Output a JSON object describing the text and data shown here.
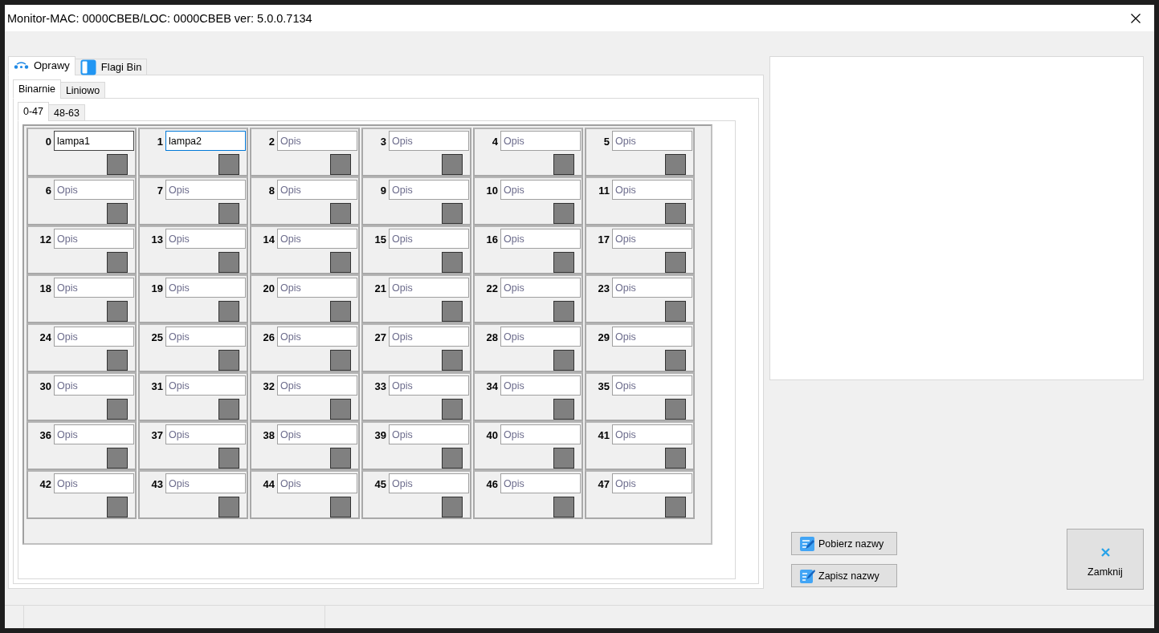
{
  "window": {
    "title": "Monitor-MAC: 0000CBEB/LOC: 0000CBEB ver: 5.0.0.7134"
  },
  "main_tabs": [
    {
      "label": "Oprawy",
      "kind": "lamps",
      "selected": true
    },
    {
      "label": "Flagi Bin",
      "kind": "flags",
      "selected": false
    }
  ],
  "mode_tabs": [
    {
      "label": "Binarnie",
      "selected": true
    },
    {
      "label": "Liniowo",
      "selected": false
    }
  ],
  "range_tabs": [
    {
      "label": "0-47",
      "selected": true
    },
    {
      "label": "48-63",
      "selected": false
    }
  ],
  "cells": [
    {
      "number": "0",
      "value": "lampa1",
      "focused": false
    },
    {
      "number": "1",
      "value": "lampa2",
      "focused": true
    },
    {
      "number": "2",
      "placeholder": "Opis",
      "focused": false
    },
    {
      "number": "3",
      "placeholder": "Opis",
      "focused": false
    },
    {
      "number": "4",
      "placeholder": "Opis",
      "focused": false
    },
    {
      "number": "5",
      "placeholder": "Opis",
      "focused": false
    },
    {
      "number": "6",
      "placeholder": "Opis",
      "focused": false
    },
    {
      "number": "7",
      "placeholder": "Opis",
      "focused": false
    },
    {
      "number": "8",
      "placeholder": "Opis",
      "focused": false
    },
    {
      "number": "9",
      "placeholder": "Opis",
      "focused": false
    },
    {
      "number": "10",
      "placeholder": "Opis",
      "focused": false
    },
    {
      "number": "11",
      "placeholder": "Opis",
      "focused": false
    },
    {
      "number": "12",
      "placeholder": "Opis",
      "focused": false
    },
    {
      "number": "13",
      "placeholder": "Opis",
      "focused": false
    },
    {
      "number": "14",
      "placeholder": "Opis",
      "focused": false
    },
    {
      "number": "15",
      "placeholder": "Opis",
      "focused": false
    },
    {
      "number": "16",
      "placeholder": "Opis",
      "focused": false
    },
    {
      "number": "17",
      "placeholder": "Opis",
      "focused": false
    },
    {
      "number": "18",
      "placeholder": "Opis",
      "focused": false
    },
    {
      "number": "19",
      "placeholder": "Opis",
      "focused": false
    },
    {
      "number": "20",
      "placeholder": "Opis",
      "focused": false
    },
    {
      "number": "21",
      "placeholder": "Opis",
      "focused": false
    },
    {
      "number": "22",
      "placeholder": "Opis",
      "focused": false
    },
    {
      "number": "23",
      "placeholder": "Opis",
      "focused": false
    },
    {
      "number": "24",
      "placeholder": "Opis",
      "focused": false
    },
    {
      "number": "25",
      "placeholder": "Opis",
      "focused": false
    },
    {
      "number": "26",
      "placeholder": "Opis",
      "focused": false
    },
    {
      "number": "27",
      "placeholder": "Opis",
      "focused": false
    },
    {
      "number": "28",
      "placeholder": "Opis",
      "focused": false
    },
    {
      "number": "29",
      "placeholder": "Opis",
      "focused": false
    },
    {
      "number": "30",
      "placeholder": "Opis",
      "focused": false
    },
    {
      "number": "31",
      "placeholder": "Opis",
      "focused": false
    },
    {
      "number": "32",
      "placeholder": "Opis",
      "focused": false
    },
    {
      "number": "33",
      "placeholder": "Opis",
      "focused": false
    },
    {
      "number": "34",
      "placeholder": "Opis",
      "focused": false
    },
    {
      "number": "35",
      "placeholder": "Opis",
      "focused": false
    },
    {
      "number": "36",
      "placeholder": "Opis",
      "focused": false
    },
    {
      "number": "37",
      "placeholder": "Opis",
      "focused": false
    },
    {
      "number": "38",
      "placeholder": "Opis",
      "focused": false
    },
    {
      "number": "39",
      "placeholder": "Opis",
      "focused": false
    },
    {
      "number": "40",
      "placeholder": "Opis",
      "focused": false
    },
    {
      "number": "41",
      "placeholder": "Opis",
      "focused": false
    },
    {
      "number": "42",
      "placeholder": "Opis",
      "focused": false
    },
    {
      "number": "43",
      "placeholder": "Opis",
      "focused": false
    },
    {
      "number": "44",
      "placeholder": "Opis",
      "focused": false
    },
    {
      "number": "45",
      "placeholder": "Opis",
      "focused": false
    },
    {
      "number": "46",
      "placeholder": "Opis",
      "focused": false
    },
    {
      "number": "47",
      "placeholder": "Opis",
      "focused": false
    }
  ],
  "name_buttons": [
    {
      "label": "Pobierz nazwy",
      "kind": "download"
    },
    {
      "label": "Zapisz nazwy",
      "kind": "save"
    }
  ],
  "close_button": {
    "label": "Zamknij"
  }
}
